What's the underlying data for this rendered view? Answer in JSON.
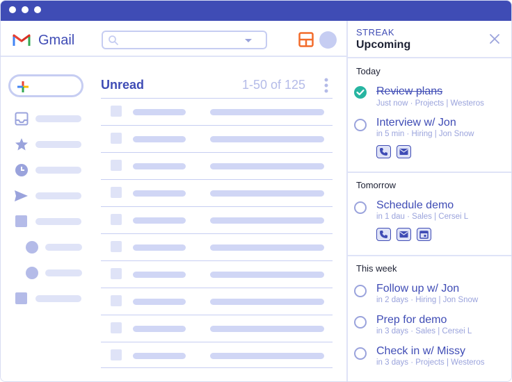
{
  "gmail": {
    "app_name": "Gmail",
    "unread_title": "Unread",
    "range_text": "1-50 of 125"
  },
  "streak": {
    "brand": "STREAK",
    "title": "Upcoming",
    "sections": {
      "today": {
        "label": "Today",
        "tasks": [
          {
            "title": "Review plans",
            "meta": "Just now · Projects | Westeros",
            "done": true
          },
          {
            "title": "Interview w/ Jon",
            "meta": "in 5 min · Hiring | Jon Snow",
            "actions": [
              "phone-icon",
              "mail-icon"
            ]
          }
        ]
      },
      "tomorrow": {
        "label": "Tomorrow",
        "tasks": [
          {
            "title": "Schedule demo",
            "meta": "in 1 dau · Sales | Cersei L",
            "actions": [
              "phone-icon",
              "mail-icon",
              "calendar-icon"
            ]
          }
        ]
      },
      "this_week": {
        "label": "This week",
        "tasks": [
          {
            "title": "Follow up w/ Jon",
            "meta": "in 2 days · Hiring | Jon Snow"
          },
          {
            "title": "Prep for demo",
            "meta": "in 3 days · Sales | Cersei L"
          },
          {
            "title": "Check in w/ Missy",
            "meta": "in 3 days · Projects | Westeros"
          }
        ]
      }
    }
  },
  "colors": {
    "accent": "#3f4cb5",
    "placeholder": "#dfe3f7",
    "done": "#27b5a1",
    "layout_icon": "#f26b2a"
  }
}
